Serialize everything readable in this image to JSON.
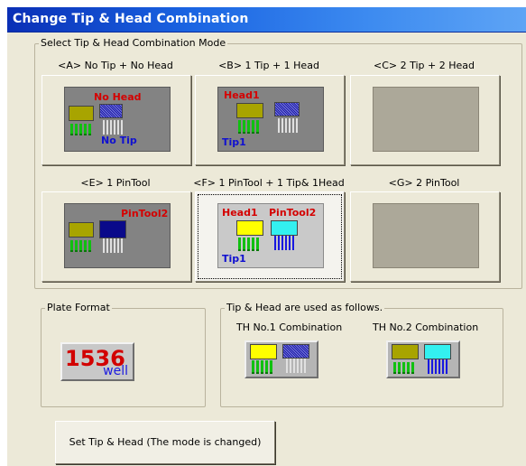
{
  "window": {
    "title": "Change Tip & Head Combination"
  },
  "mode_group": {
    "legend": "Select Tip & Head Combination Mode",
    "modes": [
      {
        "label": "<A>  No Tip + No Head",
        "img_top": "No Head",
        "img_bottom": "No Tip"
      },
      {
        "label": "<B>  1 Tip + 1 Head",
        "img_top": "Head1",
        "img_bottom": "Tip1"
      },
      {
        "label": "<C>  2 Tip + 2 Head"
      },
      {
        "label": "<E>  1 PinTool",
        "img_top": "PinTool2"
      },
      {
        "label": "<F>  1 PinTool + 1 Tip& 1Head",
        "img_top_left": "Head1",
        "img_top_right": "PinTool2",
        "img_bottom": "Tip1",
        "selected": true
      },
      {
        "label": "<G>  2 PinTool"
      }
    ]
  },
  "plate_group": {
    "legend": "Plate Format",
    "number": "1536",
    "unit": "well"
  },
  "usage_group": {
    "legend": "Tip & Head are used as follows.",
    "th1_label": "TH No.1 Combination",
    "th2_label": "TH No.2 Combination"
  },
  "action": {
    "set_label": "Set Tip & Head (The mode is changed)"
  },
  "colors": {
    "title_bar": "#1a64e2",
    "dialog_bg": "#ece9d8",
    "label_red": "#d40000",
    "label_blue": "#1010d0",
    "tip_green": "#10c010",
    "head_yellow": "#ffff00",
    "pintool_cyan": "#33f0f0"
  }
}
